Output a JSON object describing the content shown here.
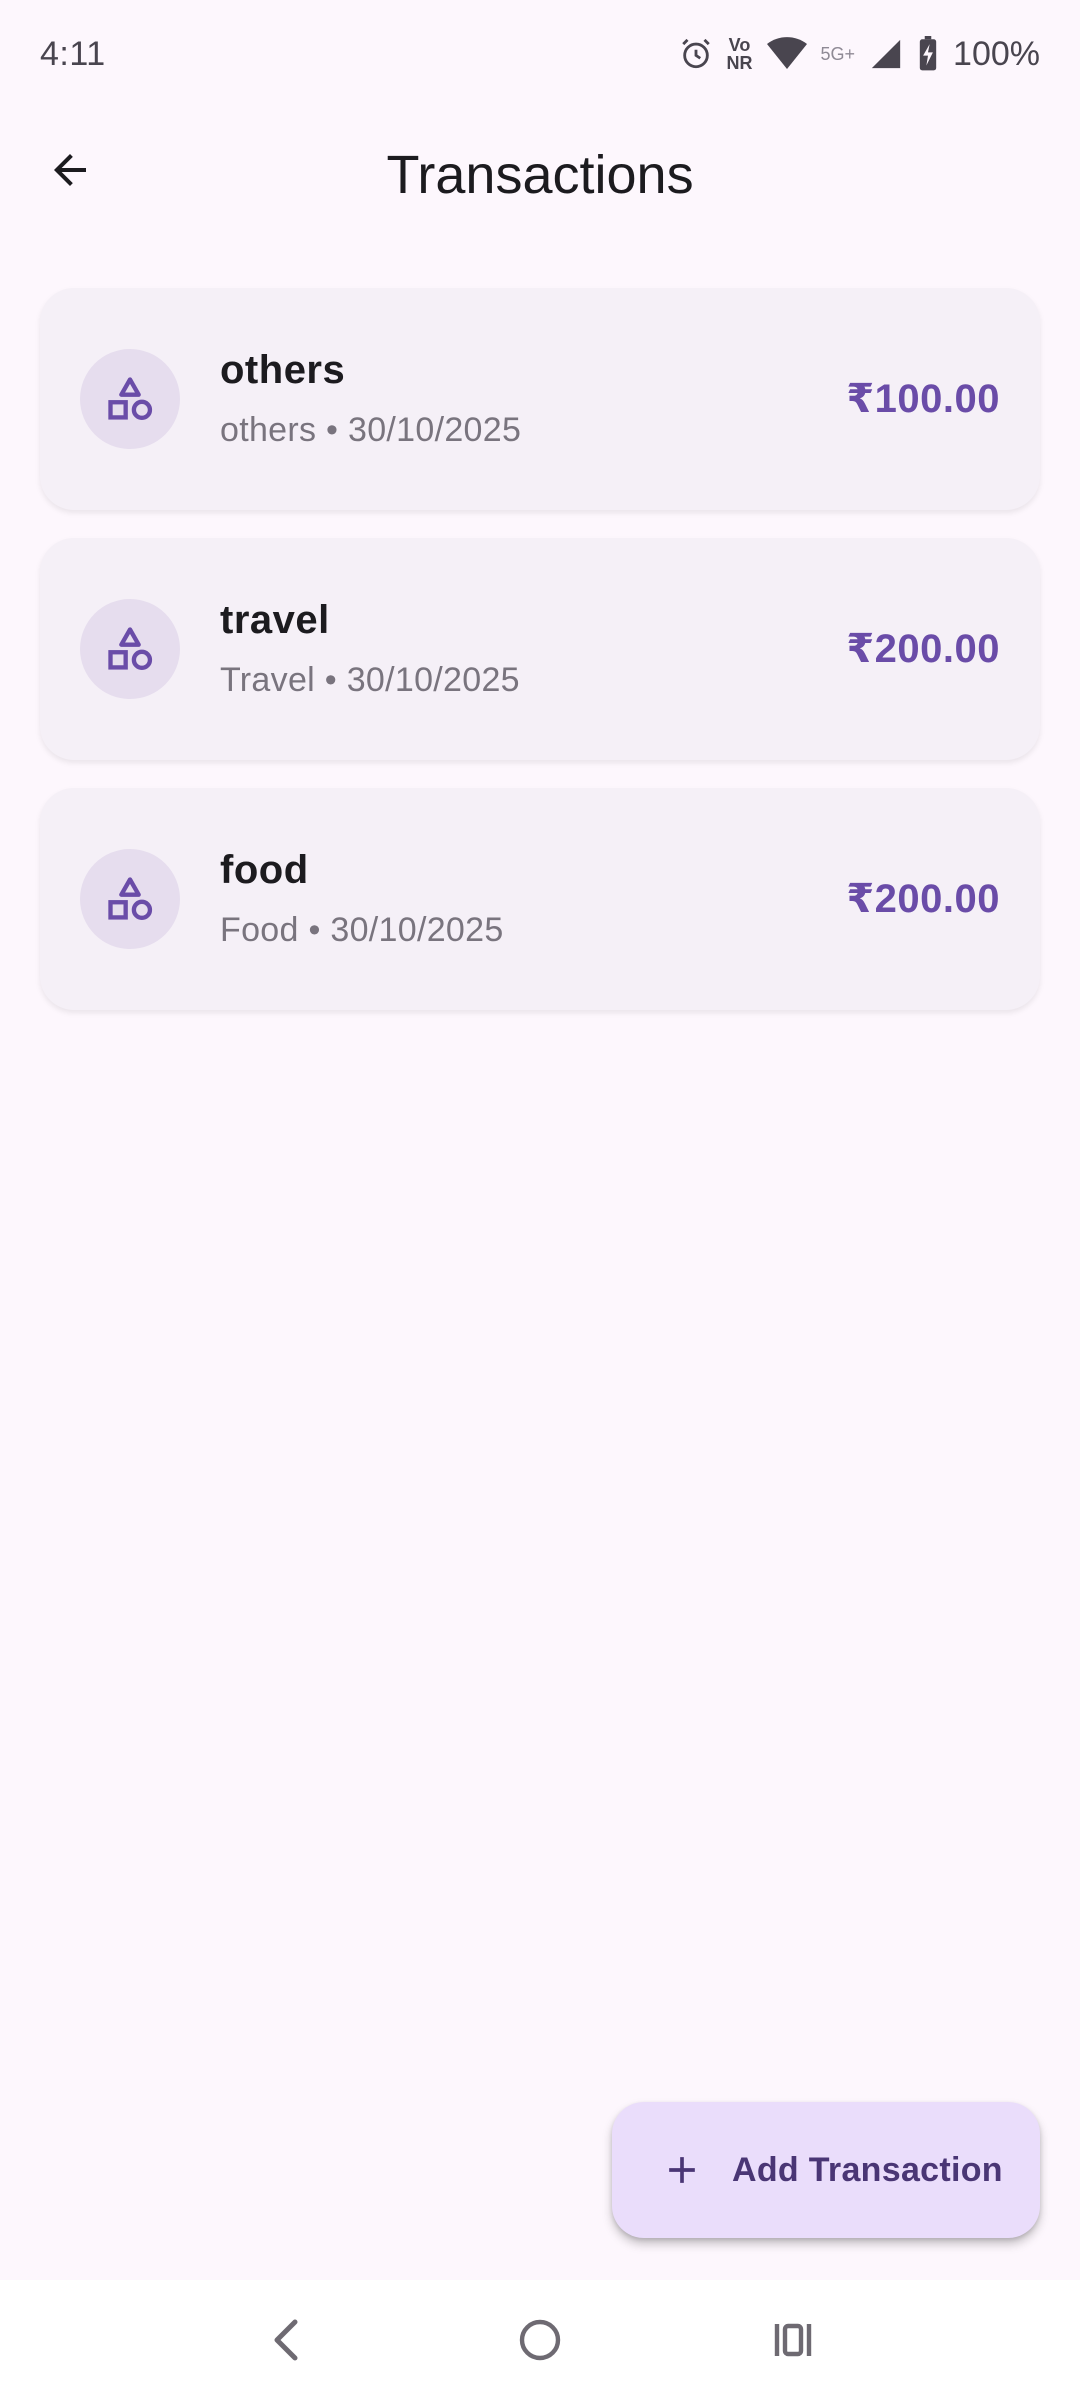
{
  "status_bar": {
    "time": "4:11",
    "network_label_top": "Vo",
    "network_label_bottom": "NR",
    "signal_label": "5G+",
    "battery": "100%"
  },
  "app_bar": {
    "title": "Transactions",
    "back_icon": "arrow-back-icon"
  },
  "transactions": [
    {
      "title": "others",
      "subtitle": "others • 30/10/2025",
      "amount": "₹100.00",
      "icon": "category-shapes-icon"
    },
    {
      "title": "travel",
      "subtitle": "Travel • 30/10/2025",
      "amount": "₹200.00",
      "icon": "category-shapes-icon"
    },
    {
      "title": "food",
      "subtitle": "Food • 30/10/2025",
      "amount": "₹200.00",
      "icon": "category-shapes-icon"
    }
  ],
  "fab": {
    "label": "Add Transaction",
    "icon": "plus-icon"
  },
  "nav_bar": {
    "back_icon": "nav-back-icon",
    "home_icon": "nav-home-icon",
    "recents_icon": "nav-recents-icon"
  },
  "colors": {
    "background": "#FDF7FD",
    "card": "#F5F0F7",
    "avatar": "#E6DDEE",
    "accent": "#6A4CA8",
    "fab": "#EADDFB"
  }
}
